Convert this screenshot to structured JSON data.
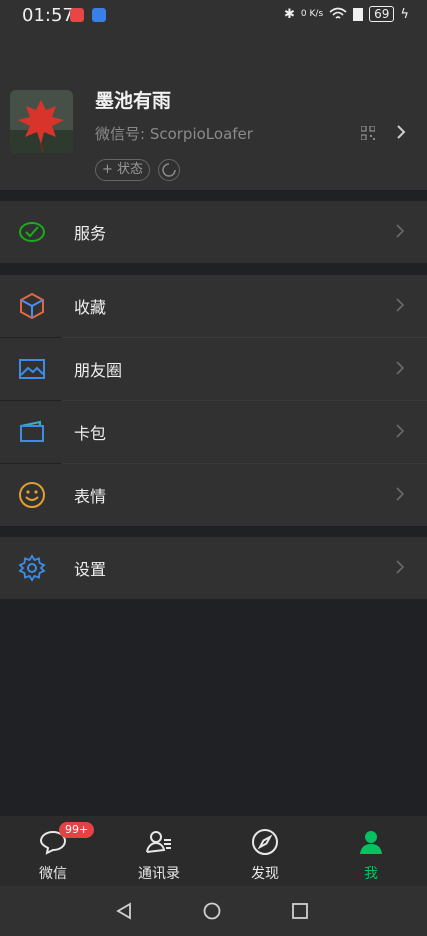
{
  "status_bar": {
    "time": "01:57",
    "speed": "0 K/s",
    "battery": "69"
  },
  "profile": {
    "name": "墨池有雨",
    "wechat_id": "微信号: ScorpioLoafer",
    "status_button": "+ 状态"
  },
  "menu": {
    "services": "服务",
    "favorites": "收藏",
    "moments": "朋友圈",
    "cards": "卡包",
    "stickers": "表情",
    "settings": "设置"
  },
  "tabs": [
    {
      "label": "微信",
      "badge": "99+"
    },
    {
      "label": "通讯录"
    },
    {
      "label": "发现"
    },
    {
      "label": "我"
    }
  ],
  "colors": {
    "accent": "#07c160",
    "badge": "#e24343"
  }
}
